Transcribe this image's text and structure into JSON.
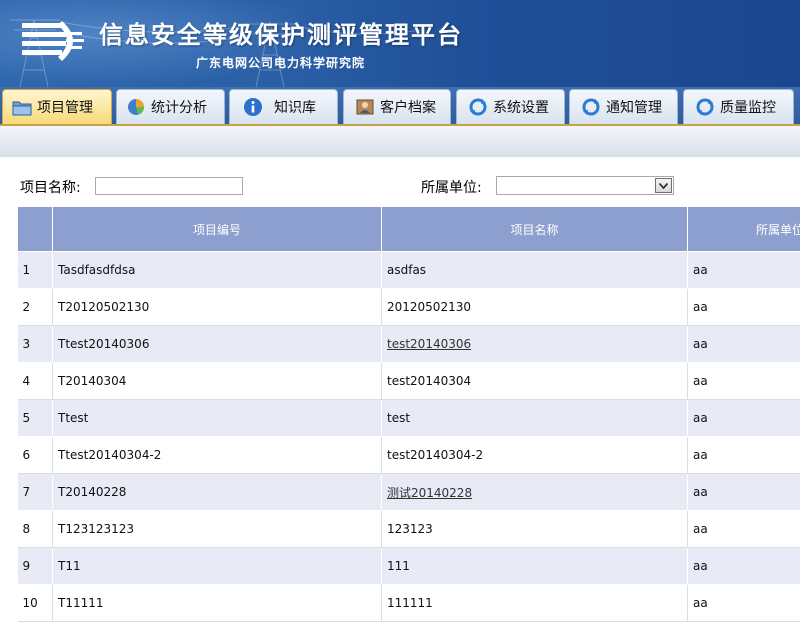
{
  "header": {
    "title": "信息安全等级保护测评管理平台",
    "subtitle": "广东电网公司电力科学研究院"
  },
  "tabs": [
    {
      "label": "项目管理",
      "icon": "folder-icon",
      "active": true
    },
    {
      "label": "统计分析",
      "icon": "pie-chart-icon",
      "active": false
    },
    {
      "label": "知识库",
      "icon": "info-icon",
      "active": false
    },
    {
      "label": "客户档案",
      "icon": "customer-icon",
      "active": false
    },
    {
      "label": "系统设置",
      "icon": "refresh-icon",
      "active": false
    },
    {
      "label": "通知管理",
      "icon": "refresh-icon",
      "active": false
    },
    {
      "label": "质量监控",
      "icon": "refresh-icon",
      "active": false
    }
  ],
  "filters": {
    "project_name_label": "项目名称:",
    "project_name_value": "",
    "unit_label": "所属单位:",
    "unit_value": ""
  },
  "table": {
    "columns": [
      "",
      "项目编号",
      "项目名称",
      "所属单位"
    ],
    "rows": [
      {
        "idx": "1",
        "code": "Tasdfasdfdsa",
        "name": "asdfas",
        "unit": "aa",
        "link": false
      },
      {
        "idx": "2",
        "code": "T20120502130",
        "name": "20120502130",
        "unit": "aa",
        "link": false
      },
      {
        "idx": "3",
        "code": "Ttest20140306",
        "name": "test20140306",
        "unit": "aa",
        "link": true
      },
      {
        "idx": "4",
        "code": "T20140304",
        "name": "test20140304",
        "unit": "aa",
        "link": false
      },
      {
        "idx": "5",
        "code": "Ttest",
        "name": "test",
        "unit": "aa",
        "link": false
      },
      {
        "idx": "6",
        "code": "Ttest20140304-2",
        "name": "test20140304-2",
        "unit": "aa",
        "link": false
      },
      {
        "idx": "7",
        "code": "T20140228",
        "name": "测试20140228",
        "unit": "aa",
        "link": true
      },
      {
        "idx": "8",
        "code": "T123123123",
        "name": "123123",
        "unit": "aa",
        "link": false
      },
      {
        "idx": "9",
        "code": "T11",
        "name": "111",
        "unit": "aa",
        "link": false
      },
      {
        "idx": "10",
        "code": "T11111",
        "name": "111111",
        "unit": "aa",
        "link": false
      }
    ]
  },
  "colors": {
    "banner": "#2a5fa6",
    "table_header": "#8d9fce",
    "row_alt": "#e8eaf6",
    "active_tab": "#f7d97a"
  }
}
